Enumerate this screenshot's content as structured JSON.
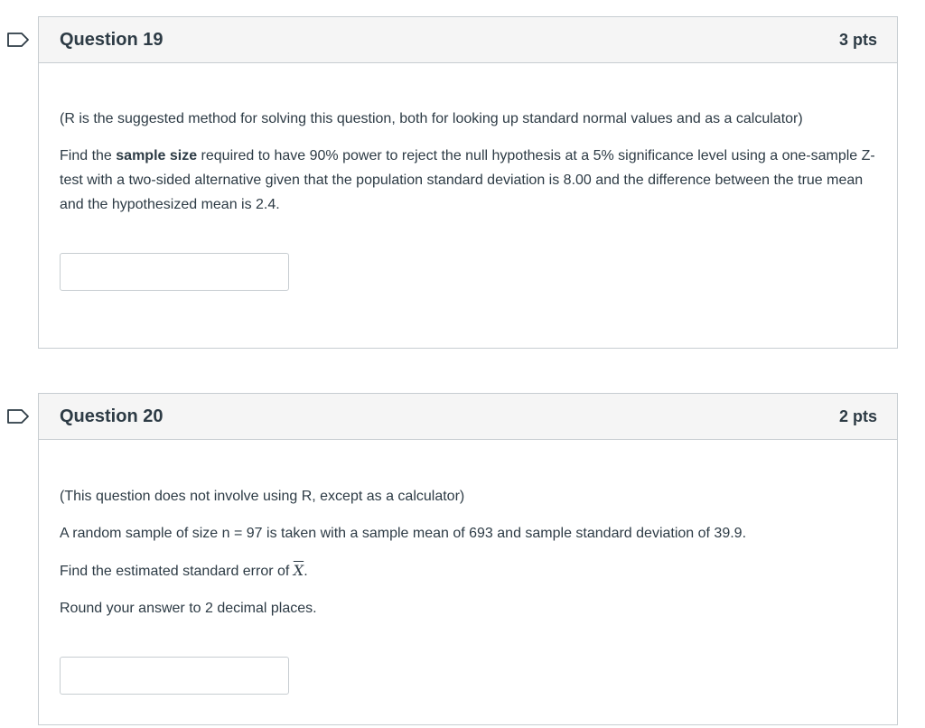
{
  "questions": [
    {
      "title": "Question 19",
      "points": "3 pts",
      "note": "(R is the suggested method for solving this question, both for looking up standard normal values and as a calculator)",
      "prompt_before_bold": "Find the ",
      "prompt_bold": "sample size",
      "prompt_after_bold": " required to have 90% power to reject the null hypothesis at a 5% significance level using a one-sample Z-test with a two-sided alternative given that the population standard deviation is 8.00 and the difference between the true mean and the hypothesized mean is 2.4.",
      "answer_value": ""
    },
    {
      "title": "Question 20",
      "points": "2 pts",
      "note": "(This question does not involve using R, except as a calculator)",
      "line1": "A random sample of size n = 97 is taken with a sample mean of 693 and sample standard deviation of 39.9.",
      "line2_before": "Find the estimated standard error of ",
      "line2_symbol": "X",
      "line2_after": ".",
      "line3": "Round your answer to 2 decimal places.",
      "answer_value": ""
    }
  ],
  "colors": {
    "flag": "#2d3b45",
    "border": "#c7cdd1",
    "header_bg": "#f5f5f5",
    "text": "#2d3b45"
  },
  "icons": [
    "flag-question-icon"
  ]
}
